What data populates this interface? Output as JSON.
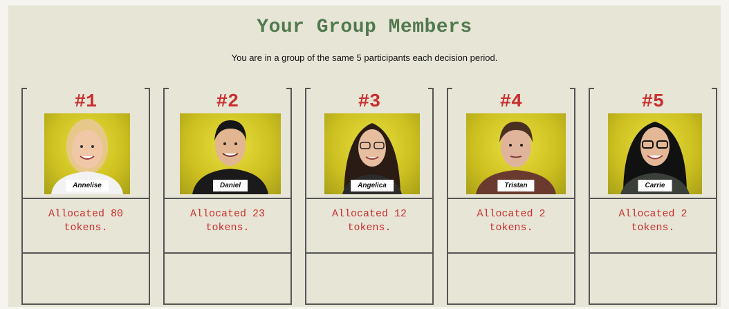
{
  "page": {
    "title": "Your Group Members",
    "subtitle": "You are in a group of the same 5 participants each decision period."
  },
  "members": [
    {
      "number": "#1",
      "name": "Annelise",
      "allocation_line1": "Allocated 80",
      "allocation_line2": "tokens.",
      "hair_color": "#e6c98a",
      "shirt_color": "#f2f2f2"
    },
    {
      "number": "#2",
      "name": "Daniel",
      "allocation_line1": "Allocated 23",
      "allocation_line2": "tokens.",
      "hair_color": "#161616",
      "shirt_color": "#1a1a1a"
    },
    {
      "number": "#3",
      "name": "Angelica",
      "allocation_line1": "Allocated 12",
      "allocation_line2": "tokens.",
      "hair_color": "#2a1c14",
      "shirt_color": "#2b2b2b"
    },
    {
      "number": "#4",
      "name": "Tristan",
      "allocation_line1": "Allocated 2",
      "allocation_line2": "tokens.",
      "hair_color": "#4a3020",
      "shirt_color": "#6a3a2e"
    },
    {
      "number": "#5",
      "name": "Carrie",
      "allocation_line1": "Allocated 2",
      "allocation_line2": "tokens.",
      "hair_color": "#111111",
      "shirt_color": "#3a3f3a"
    }
  ],
  "colors": {
    "title": "#517a4f",
    "accent_red": "#c82f2f",
    "panel_bg": "#e7e5d6",
    "photo_bg": "#d8cf2a"
  }
}
